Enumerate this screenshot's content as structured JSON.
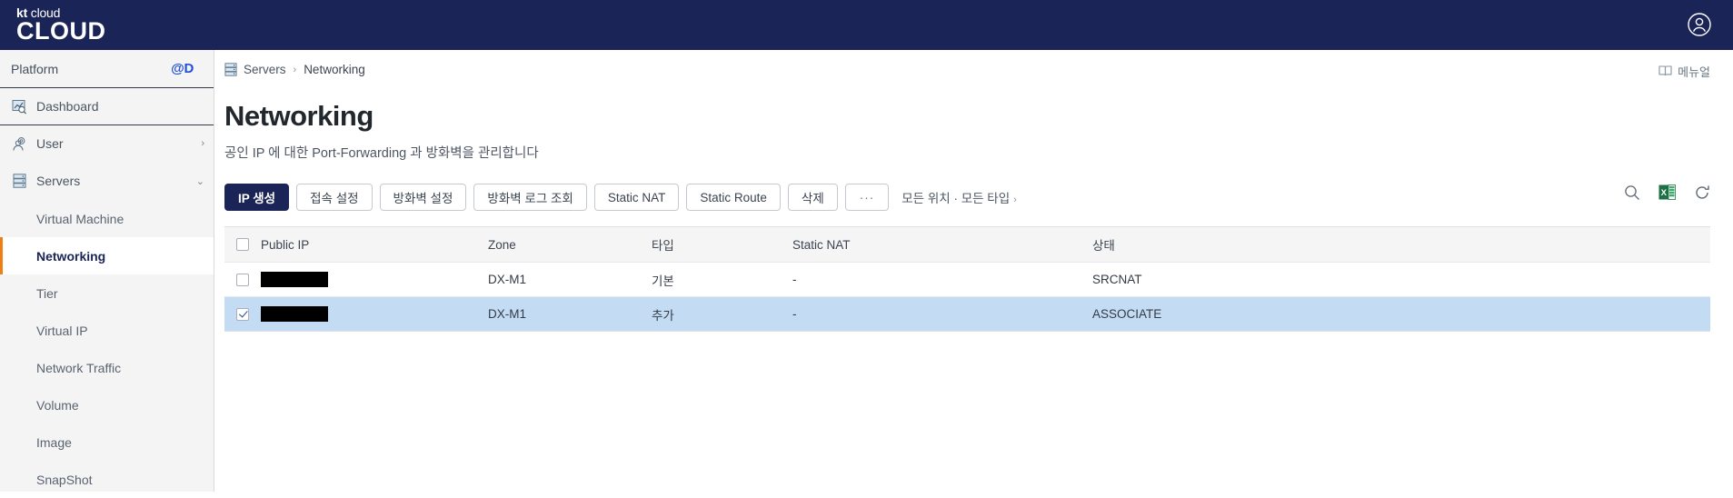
{
  "topbar": {
    "brand_kt": "kt",
    "brand_cloud_small": "cloud",
    "brand_cloud_big": "CLOUD",
    "avatar_icon": "user-circle-icon"
  },
  "sidebar": {
    "platform_label": "Platform",
    "platform_badge": "@D",
    "items": [
      {
        "label": "Dashboard",
        "icon": "dashboard-chart-icon",
        "chevron": ""
      },
      {
        "label": "User",
        "icon": "user-gear-icon",
        "chevron": "›"
      },
      {
        "label": "Servers",
        "icon": "server-rack-icon",
        "chevron": "⌄"
      }
    ],
    "sub_items": [
      {
        "label": "Virtual Machine",
        "active": false
      },
      {
        "label": "Networking",
        "active": true
      },
      {
        "label": "Tier",
        "active": false
      },
      {
        "label": "Virtual IP",
        "active": false
      },
      {
        "label": "Network Traffic",
        "active": false
      },
      {
        "label": "Volume",
        "active": false
      },
      {
        "label": "Image",
        "active": false
      },
      {
        "label": "SnapShot",
        "active": false
      }
    ]
  },
  "breadcrumb": {
    "icon": "server-rack-icon",
    "parent": "Servers",
    "separator": "›",
    "current": "Networking"
  },
  "manual": {
    "icon": "book-icon",
    "label": "메뉴얼"
  },
  "page": {
    "title": "Networking",
    "description": "공인 IP 에 대한 Port-Forwarding 과 방화벽을 관리합니다"
  },
  "toolbar": {
    "buttons": [
      {
        "label": "IP 생성",
        "primary": true
      },
      {
        "label": "접속 설정",
        "primary": false
      },
      {
        "label": "방화벽 설정",
        "primary": false
      },
      {
        "label": "방화벽 로그 조회",
        "primary": false
      },
      {
        "label": "Static NAT",
        "primary": false
      },
      {
        "label": "Static Route",
        "primary": false
      },
      {
        "label": "삭제",
        "primary": false
      },
      {
        "label": "···",
        "primary": false
      }
    ],
    "filter_label": "모든 위치 · 모든 타입",
    "filter_caret": "›",
    "icons": [
      {
        "name": "search-icon"
      },
      {
        "name": "excel-export-icon"
      },
      {
        "name": "refresh-icon"
      }
    ]
  },
  "table": {
    "headers": {
      "public_ip": "Public IP",
      "zone": "Zone",
      "type": "타입",
      "static_nat": "Static NAT",
      "state": "상태"
    },
    "rows": [
      {
        "checked": false,
        "selected": false,
        "public_ip": "",
        "public_ip_redacted": true,
        "zone": "DX-M1",
        "type": "기본",
        "static_nat": "-",
        "state": "SRCNAT"
      },
      {
        "checked": true,
        "selected": true,
        "public_ip": "",
        "public_ip_redacted": true,
        "zone": "DX-M1",
        "type": "추가",
        "static_nat": "-",
        "state": "ASSOCIATE"
      }
    ]
  },
  "colors": {
    "navy": "#1b2456",
    "accent_orange": "#f07f13",
    "selected_row": "#c3dcf4",
    "excel_green": "#1e7145",
    "badge_blue": "#1f4fd8"
  }
}
